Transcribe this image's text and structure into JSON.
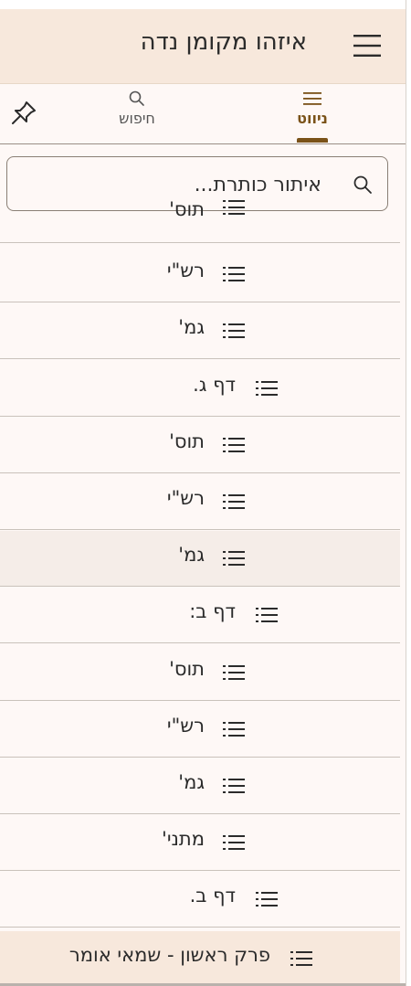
{
  "header": {
    "title": "איזהו מקומן נדה",
    "background": "#f7e8dc"
  },
  "tabs": {
    "navigation_label": "ניווט",
    "search_label": "חיפוש",
    "active_color": "#7a5218",
    "pin_icon": "pin-icon"
  },
  "filter": {
    "placeholder": "איתור כותרת...",
    "value": ""
  },
  "list": {
    "items": [
      {
        "label": "תוס'",
        "level": 2,
        "partial": true
      },
      {
        "label": "רש\"י",
        "level": 2
      },
      {
        "label": "גמ'",
        "level": 2
      },
      {
        "label": "דף ג.",
        "level": 1
      },
      {
        "label": "תוס'",
        "level": 2
      },
      {
        "label": "רש\"י",
        "level": 2
      },
      {
        "label": "גמ'",
        "level": 2,
        "selected": true
      },
      {
        "label": "דף ב:",
        "level": 1
      },
      {
        "label": "תוס'",
        "level": 2
      },
      {
        "label": "רש\"י",
        "level": 2
      },
      {
        "label": "גמ'",
        "level": 2
      },
      {
        "label": "מתני'",
        "level": 2
      },
      {
        "label": "דף ב.",
        "level": 1
      },
      {
        "label": "פרק ראשון - שמאי אומר",
        "level": 0,
        "footer": true
      }
    ],
    "selected_background": "#f5ede8"
  }
}
